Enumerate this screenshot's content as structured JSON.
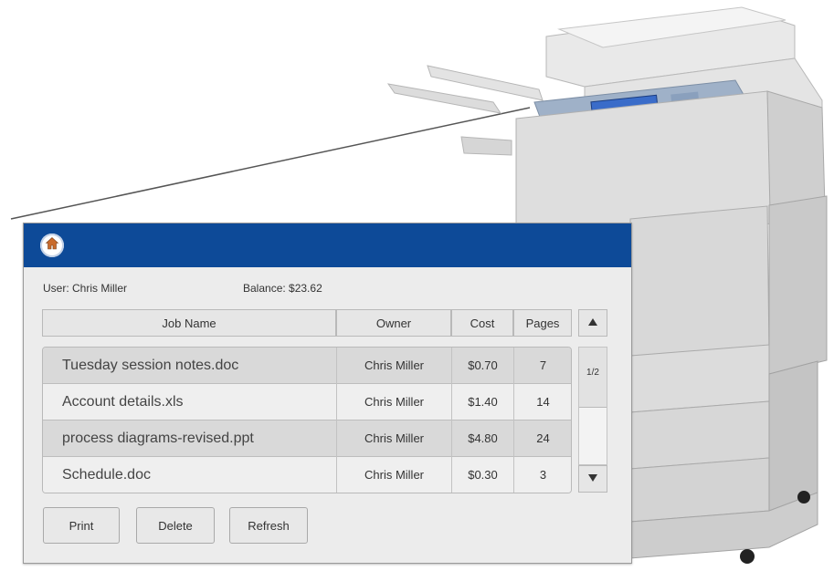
{
  "user": {
    "label": "User: Chris Miller"
  },
  "balance": {
    "label": "Balance: $23.62"
  },
  "table": {
    "headers": [
      "Job Name",
      "Owner",
      "Cost",
      "Pages"
    ],
    "rows": [
      {
        "name": "Tuesday session notes.doc",
        "owner": "Chris Miller",
        "cost": "$0.70",
        "pages": "7"
      },
      {
        "name": "Account details.xls",
        "owner": "Chris Miller",
        "cost": "$1.40",
        "pages": "14"
      },
      {
        "name": "process diagrams-revised.ppt",
        "owner": "Chris Miller",
        "cost": "$4.80",
        "pages": "24"
      },
      {
        "name": "Schedule.doc",
        "owner": "Chris Miller",
        "cost": "$0.30",
        "pages": "3"
      }
    ]
  },
  "pager": {
    "label": "1/2"
  },
  "actions": {
    "print": "Print",
    "delete": "Delete",
    "refresh": "Refresh"
  },
  "colors": {
    "titlebar": "#0d4a98",
    "panel": "#ececec",
    "row_alt": "#d9d9d9"
  },
  "icons": {
    "home": "home-icon",
    "up": "arrow-up-icon",
    "down": "arrow-down-icon"
  }
}
